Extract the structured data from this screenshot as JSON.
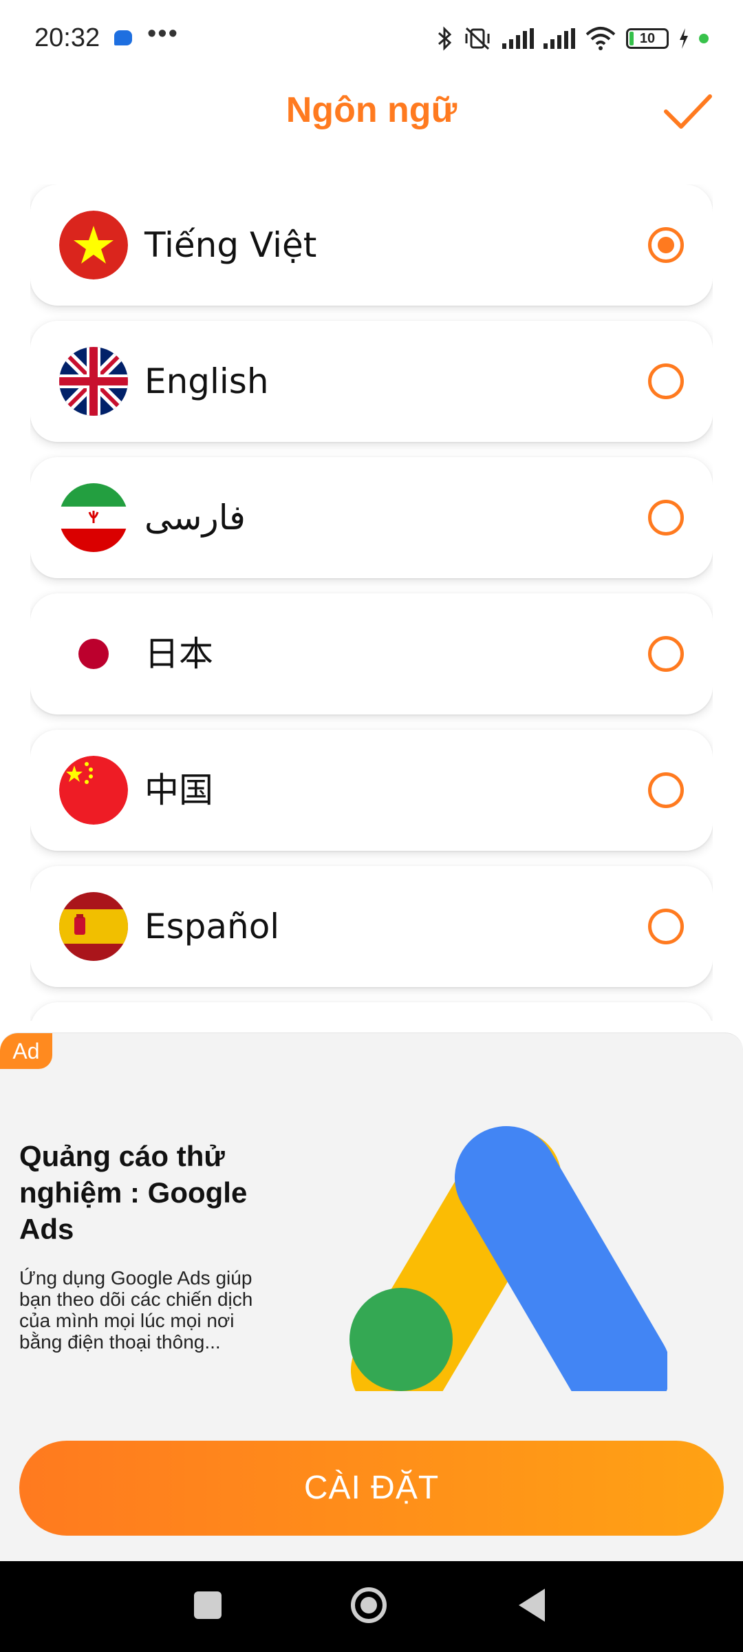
{
  "status_bar": {
    "time": "20:32",
    "battery_level": "10",
    "icons": [
      "message-icon",
      "more-dots-icon",
      "bluetooth-icon",
      "vibrate-off-icon",
      "signal-icon",
      "signal-icon",
      "wifi-icon",
      "battery-icon",
      "charging-icon"
    ]
  },
  "header": {
    "title": "Ngôn ngữ",
    "confirm_icon": "checkmark-icon",
    "accent_color": "#ff7a1f"
  },
  "languages": [
    {
      "label": "Tiếng Việt",
      "flag": "vietnam-flag-icon",
      "selected": true
    },
    {
      "label": "English",
      "flag": "uk-flag-icon",
      "selected": false
    },
    {
      "label": "فارسی",
      "flag": "iran-flag-icon",
      "selected": false
    },
    {
      "label": "日本",
      "flag": "japan-flag-icon",
      "selected": false
    },
    {
      "label": "中国",
      "flag": "china-flag-icon",
      "selected": false
    },
    {
      "label": "Español",
      "flag": "spain-flag-icon",
      "selected": false
    }
  ],
  "ad": {
    "badge": "Ad",
    "title": "Quảng cáo thử nghiệm : Google Ads",
    "description": "Ứng dụng Google Ads giúp bạn theo dõi các chiến dịch của mình mọi lúc mọi nơi bằng điện thoại thông...",
    "cta": "CÀI ĐẶT",
    "logo": "google-ads-logo"
  },
  "nav": {
    "icons": [
      "recent-apps-icon",
      "home-icon",
      "back-icon"
    ]
  }
}
